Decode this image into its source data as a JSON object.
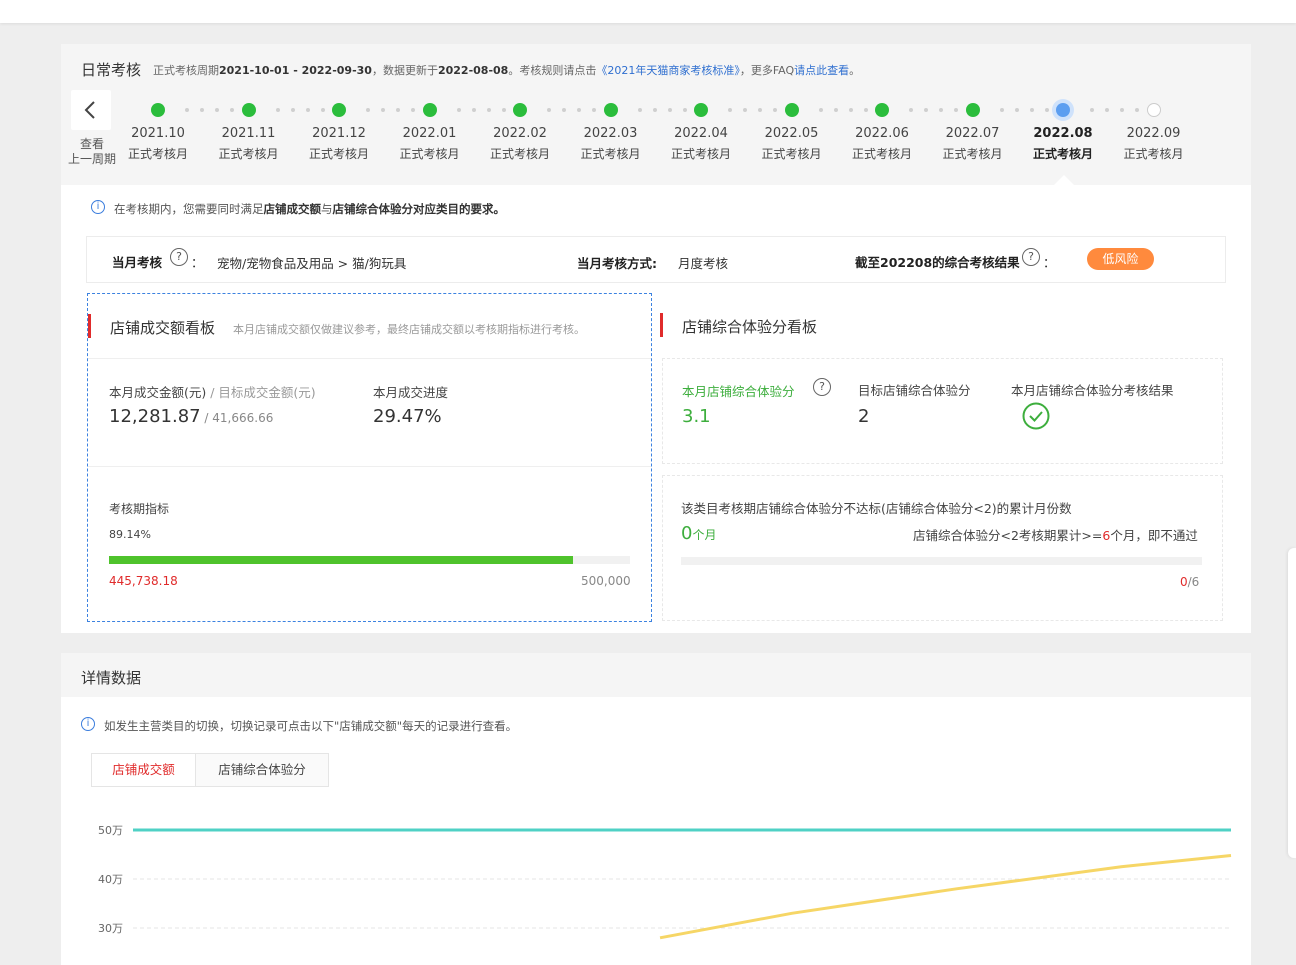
{
  "header": {
    "title": "日常考核",
    "sub_prefix": "正式考核周期",
    "period": "2021-10-01 - 2022-09-30",
    "sub_mid": "，数据更新于",
    "update_date": "2022-08-08",
    "sub_rule": "。考核规则请点击",
    "rule_link": "《2021年天猫商家考核标准》",
    "sub_faq": "，更多FAQ",
    "faq_link": "请点此查看",
    "sub_end": "。"
  },
  "timeline": {
    "prev_label_line1": "查看",
    "prev_label_line2": "上一周期",
    "months": [
      {
        "date": "2021.10",
        "label": "正式考核月",
        "status": "done"
      },
      {
        "date": "2021.11",
        "label": "正式考核月",
        "status": "done"
      },
      {
        "date": "2021.12",
        "label": "正式考核月",
        "status": "done"
      },
      {
        "date": "2022.01",
        "label": "正式考核月",
        "status": "done"
      },
      {
        "date": "2022.02",
        "label": "正式考核月",
        "status": "done"
      },
      {
        "date": "2022.03",
        "label": "正式考核月",
        "status": "done"
      },
      {
        "date": "2022.04",
        "label": "正式考核月",
        "status": "done"
      },
      {
        "date": "2022.05",
        "label": "正式考核月",
        "status": "done"
      },
      {
        "date": "2022.06",
        "label": "正式考核月",
        "status": "done"
      },
      {
        "date": "2022.07",
        "label": "正式考核月",
        "status": "done"
      },
      {
        "date": "2022.08",
        "label": "正式考核月",
        "status": "current"
      },
      {
        "date": "2022.09",
        "label": "正式考核月",
        "status": "future"
      }
    ],
    "colors": {
      "done": "#2bbd3c",
      "current": "#5c9ef0",
      "future": "#ffffff"
    }
  },
  "notice": {
    "prefix": "在考核期内，您需要同时满足",
    "bold1": "店铺成交额",
    "mid": "与",
    "bold2": "店铺综合体验分对应类目的要求。"
  },
  "assessment": {
    "month_label": "当月考核",
    "month_colon": "：",
    "category": "宠物/宠物食品及用品 > 猫/狗玩具",
    "method_label": "当月考核方式:",
    "method_value": "月度考核",
    "result_label": "截至202208的综合考核结果",
    "result_colon": "：",
    "risk_badge": "低风险",
    "risk_color": "#ff8a3d"
  },
  "sales_board": {
    "title": "店铺成交额看板",
    "note": "本月店铺成交额仅做建议参考，最终店铺成交额以考核期指标进行考核。",
    "amount_label": "本月成交金额(元)",
    "target_label": "/ 目标成交金额(元)",
    "amount_value": "12,281.87",
    "target_value": "41,666.66",
    "slash": " / ",
    "progress_label": "本月成交进度",
    "progress_value": "29.47%",
    "period_label": "考核期指标",
    "period_percent": "89.14%",
    "period_fraction": 0.8914,
    "period_current": "445,738.18",
    "period_target": "500,000"
  },
  "experience_board": {
    "title": "店铺综合体验分看板",
    "score_label": "本月店铺综合体验分",
    "score_value": "3.1",
    "target_label": "目标店铺综合体验分",
    "target_value": "2",
    "result_label": "本月店铺综合体验分考核结果",
    "result_icon": "check-circle-icon",
    "fail_desc": "该类目考核期店铺综合体验分不达标(店铺综合体验分<2)的累计月份数",
    "fail_count": "0",
    "fail_unit": "个月",
    "rule_prefix": "店铺综合体验分<2考核期累计>=",
    "rule_num": "6",
    "rule_suffix": "个月，即不通过",
    "ratio_current": "0",
    "ratio_total": "/6",
    "fail_fraction": 0
  },
  "detail": {
    "title": "详情数据",
    "notice": "如发生主营类目的切换，切换记录可点击以下\"店铺成交额\"每天的记录进行查看。",
    "tabs": [
      "店铺成交额",
      "店铺综合体验分"
    ],
    "active_tab": 0
  },
  "chart_data": {
    "type": "line",
    "y_tick_labels": [
      "50万",
      "40万",
      "30万"
    ],
    "y_ticks": [
      500000,
      400000,
      300000
    ],
    "ylim_visible": [
      280000,
      510000
    ],
    "series": [
      {
        "color": "#4fd1c5",
        "values": [
          500000,
          500000
        ]
      },
      {
        "color": "#f6d666",
        "points_x_fraction": [
          0.48,
          0.6,
          0.75,
          0.9,
          1.0
        ],
        "values": [
          280000,
          330000,
          380000,
          425000,
          448000
        ]
      }
    ]
  }
}
